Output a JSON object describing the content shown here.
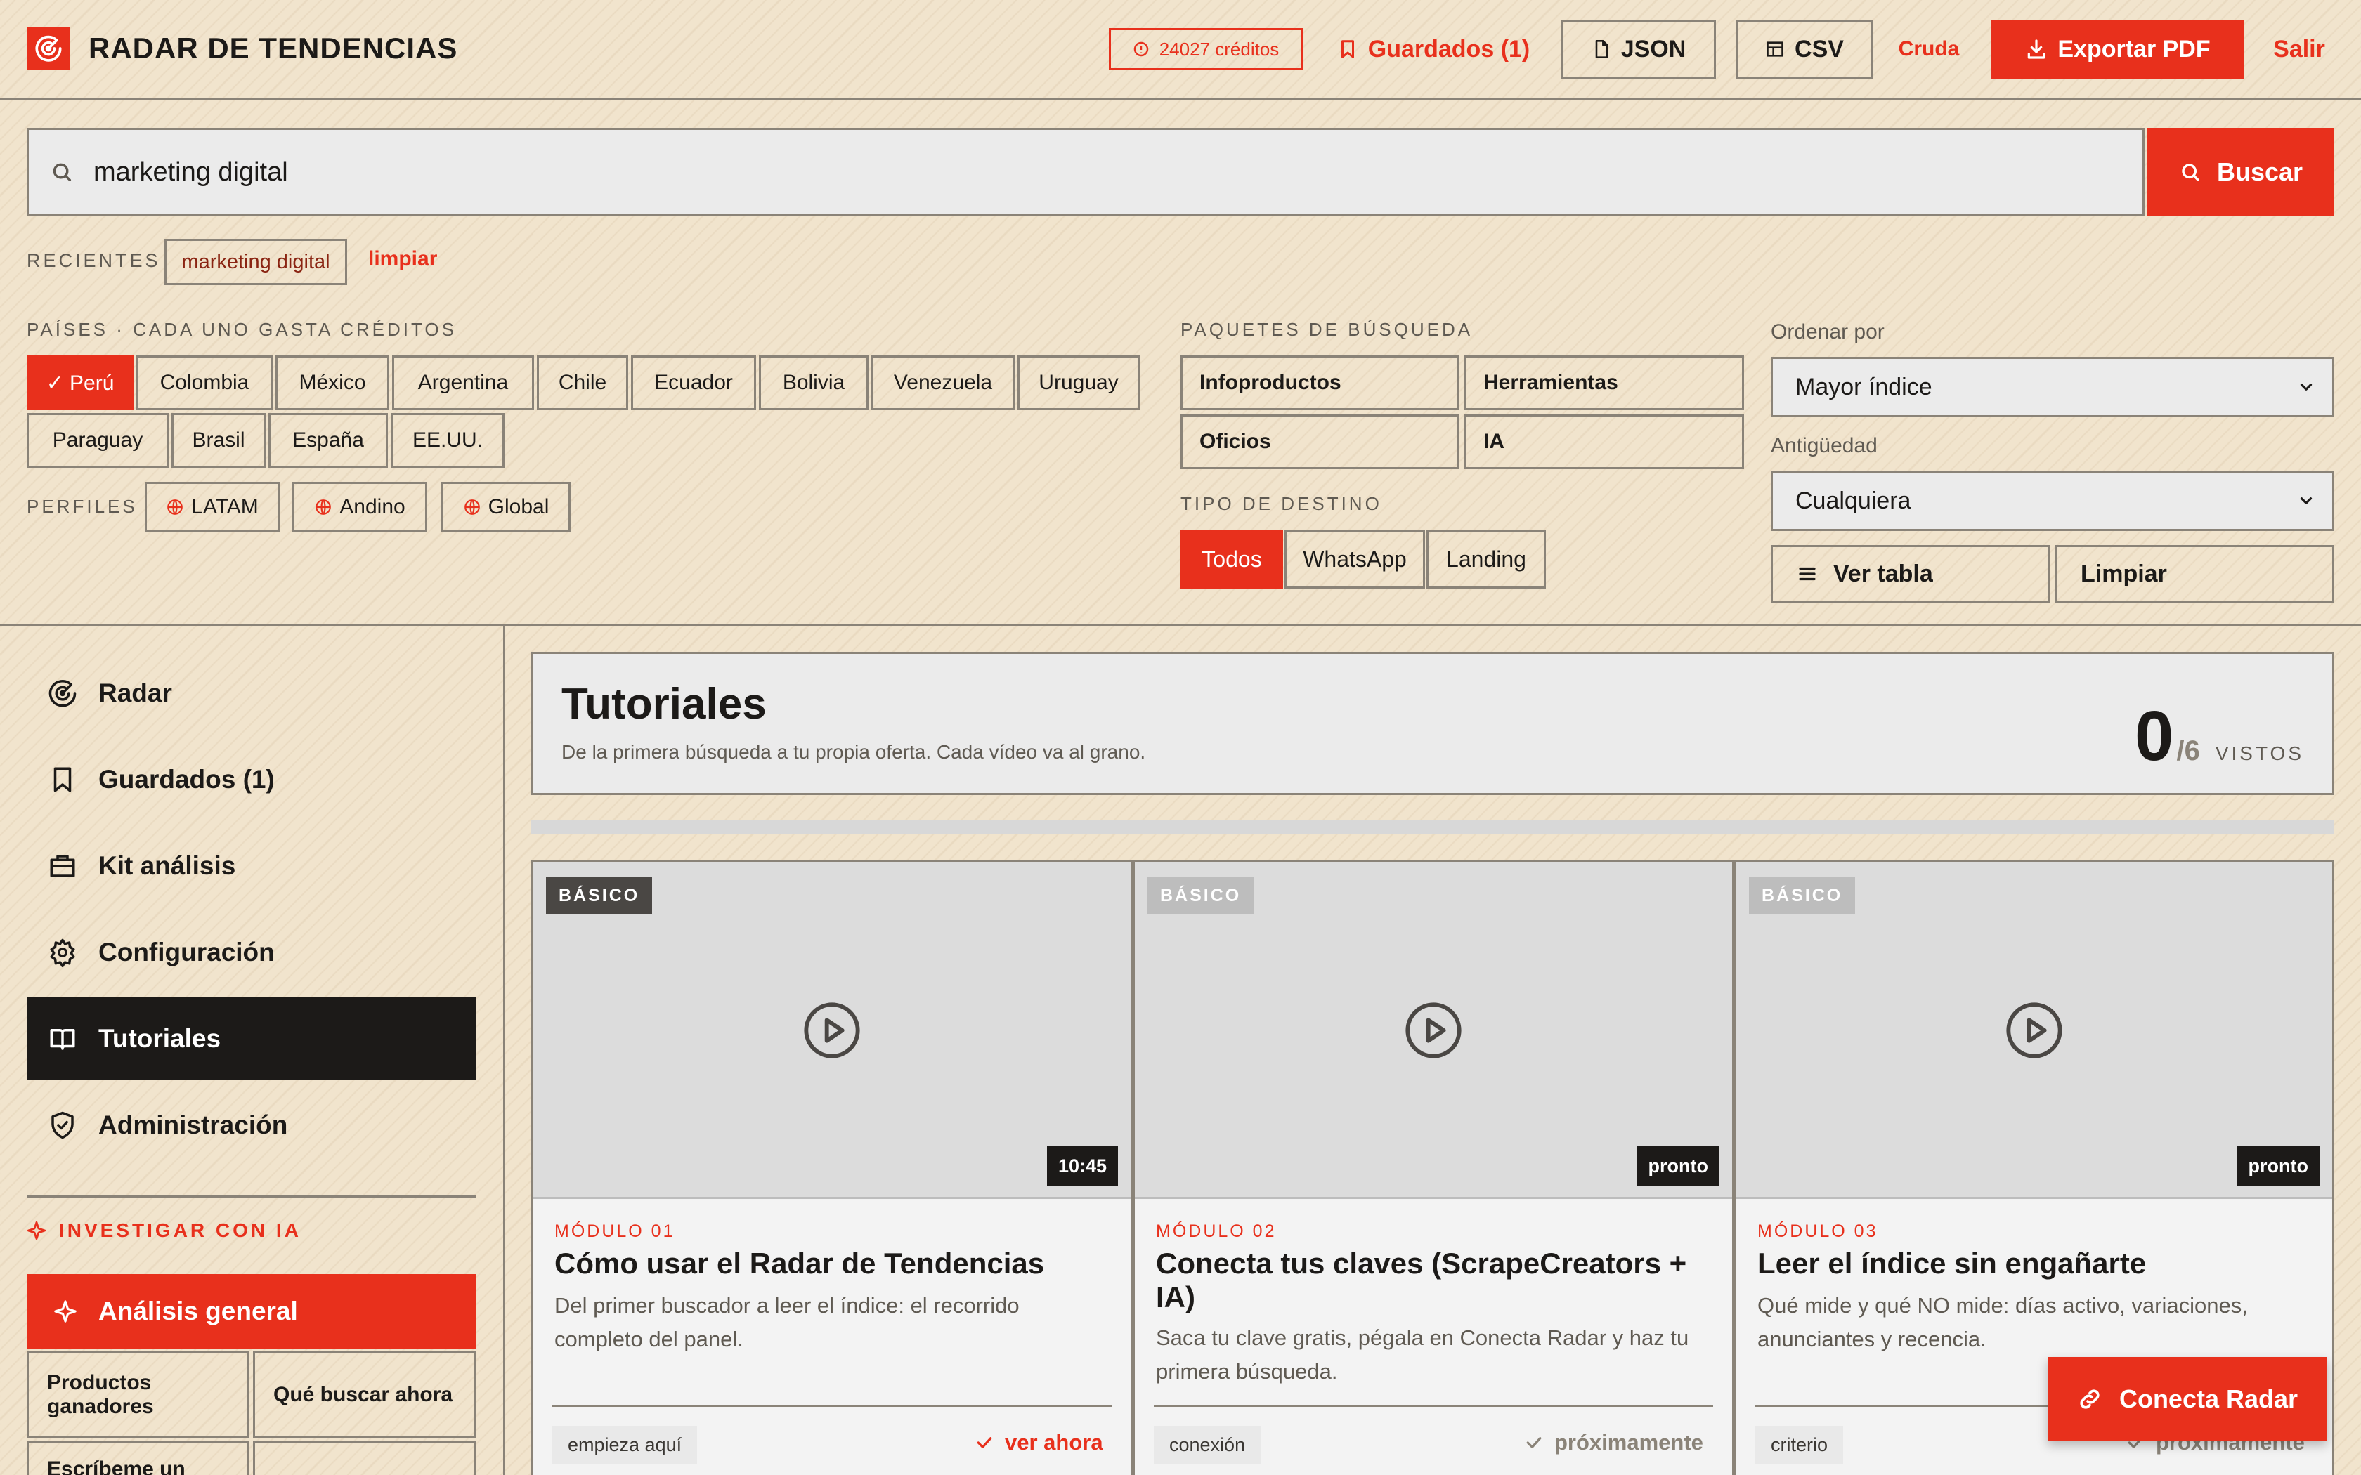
{
  "header": {
    "title": "RADAR DE TENDENCIAS",
    "credits": "24027 créditos",
    "saved": "Guardados (1)",
    "json": "JSON",
    "csv": "CSV",
    "raw": "Cruda",
    "export": "Exportar PDF",
    "logout": "Salir"
  },
  "search": {
    "value": "marketing digital",
    "placeholder": "",
    "button": "Buscar"
  },
  "recent": {
    "label": "RECIENTES",
    "items": [
      "marketing digital"
    ],
    "clear": "limpiar"
  },
  "countries": {
    "label": "PAÍSES · CADA UNO GASTA CRÉDITOS",
    "items": [
      "✓ Perú",
      "Colombia",
      "México",
      "Argentina",
      "Chile",
      "Ecuador",
      "Bolivia",
      "Venezuela",
      "Uruguay",
      "Paraguay",
      "Brasil",
      "España",
      "EE.UU."
    ],
    "selected": "Perú"
  },
  "profiles": {
    "label": "PERFILES",
    "items": [
      "LATAM",
      "Andino",
      "Global"
    ]
  },
  "packages": {
    "label": "PAQUETES DE BÚSQUEDA",
    "items": [
      "Infoproductos",
      "Herramientas",
      "Oficios",
      "IA"
    ]
  },
  "destination": {
    "label": "TIPO DE DESTINO",
    "items": [
      "Todos",
      "WhatsApp",
      "Landing"
    ],
    "selected": "Todos"
  },
  "sort": {
    "label": "Ordenar por",
    "value": "Mayor índice"
  },
  "age": {
    "label": "Antigüedad",
    "value": "Cualquiera"
  },
  "actions": {
    "table": "Ver tabla",
    "clear": "Limpiar"
  },
  "sidebar": {
    "items": [
      {
        "label": "Radar",
        "icon": "radar-icon"
      },
      {
        "label": "Guardados (1)",
        "icon": "bookmark-icon"
      },
      {
        "label": "Kit análisis",
        "icon": "briefcase-icon"
      },
      {
        "label": "Configuración",
        "icon": "gear-icon"
      },
      {
        "label": "Tutoriales",
        "icon": "book-icon",
        "active": true
      },
      {
        "label": "Administración",
        "icon": "shield-icon"
      }
    ],
    "ia_label": "INVESTIGAR CON IA",
    "ia_main": "Análisis general",
    "ia_items": [
      "Productos ganadores",
      "Qué buscar ahora",
      "Escríbeme un",
      ""
    ]
  },
  "tutorials": {
    "title": "Tutoriales",
    "subtitle": "De la primera búsqueda a tu propia oferta. Cada vídeo va al grano.",
    "watched": "0",
    "total": "/6",
    "watched_label": "VISTOS",
    "progress": 0,
    "cards": [
      {
        "level": "BÁSICO",
        "duration": "10:45",
        "module": "MÓDULO 01",
        "title": "Cómo usar el Radar de Tendencias",
        "desc": "Del primer buscador a leer el índice: el recorrido completo del panel.",
        "tag": "empieza aquí",
        "status": "ver ahora"
      },
      {
        "level": "BÁSICO",
        "duration": "pronto",
        "module": "MÓDULO 02",
        "title": "Conecta tus claves (ScrapeCreators + IA)",
        "desc": "Saca tu clave gratis, pégala en Conecta Radar y haz tu primera búsqueda.",
        "tag": "conexión",
        "status": "próximamente"
      },
      {
        "level": "BÁSICO",
        "duration": "pronto",
        "module": "MÓDULO 03",
        "title": "Leer el índice sin engañarte",
        "desc": "Qué mide y qué NO mide: días activo, variaciones, anunciantes y recencia.",
        "tag": "criterio",
        "status": "próximamente"
      }
    ]
  },
  "fab": {
    "label": "Conecta Radar"
  },
  "colors": {
    "accent": "#e8301c",
    "background": "#f1e4cd",
    "dark": "#1c1a18"
  }
}
